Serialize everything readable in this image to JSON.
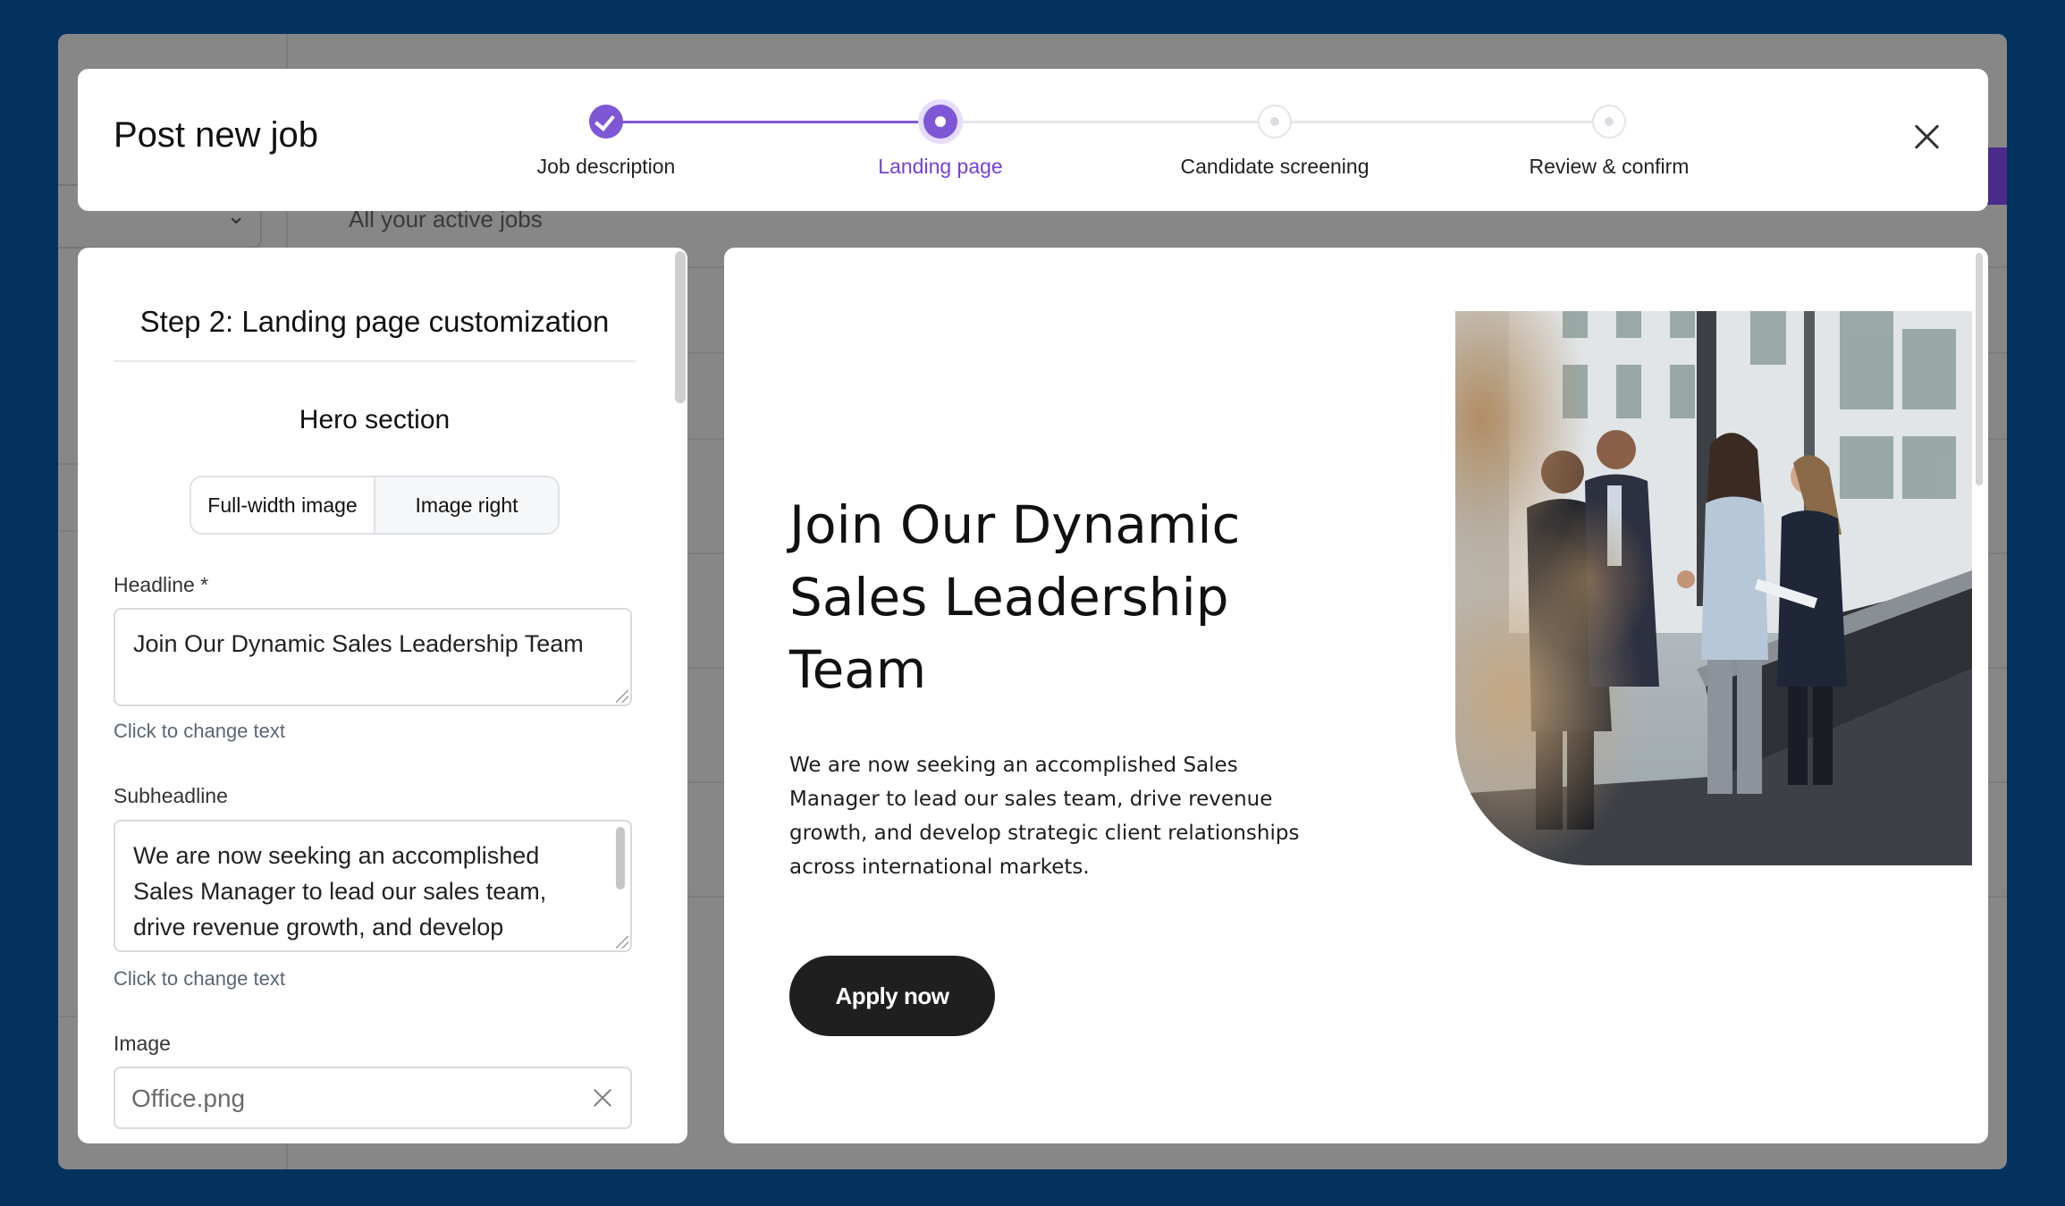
{
  "header": {
    "title": "Post new job",
    "steps": [
      {
        "label": "Job description",
        "state": "done"
      },
      {
        "label": "Landing page",
        "state": "current"
      },
      {
        "label": "Candidate screening",
        "state": "todo"
      },
      {
        "label": "Review & confirm",
        "state": "todo"
      }
    ],
    "close_icon": "close-icon"
  },
  "background": {
    "active_jobs_text": "All your active jobs"
  },
  "panel": {
    "title": "Step 2: Landing page customization",
    "section_title": "Hero section",
    "layout_options": [
      "Full-width image",
      "Image right"
    ],
    "selected_layout": "Image right",
    "headline": {
      "label": "Headline *",
      "value": "Join Our Dynamic Sales Leadership Team",
      "help": "Click to change text"
    },
    "subheadline": {
      "label": "Subheadline",
      "value": "We are now seeking an accomplished Sales Manager to lead our sales team, drive revenue growth, and develop strategic client relationships across international markets.",
      "help": "Click to change text"
    },
    "image": {
      "label": "Image",
      "value": "Office.png"
    }
  },
  "preview": {
    "headline": "Join Our Dynamic Sales Leadership Team",
    "subheadline": "We are now seeking an accomplished Sales Manager to lead our sales team, drive revenue growth, and develop strategic client relationships across international markets.",
    "cta_label": "Apply now"
  },
  "colors": {
    "backdrop": "#04325f",
    "accent": "#7e57d6",
    "cta": "#1f1f1f"
  }
}
